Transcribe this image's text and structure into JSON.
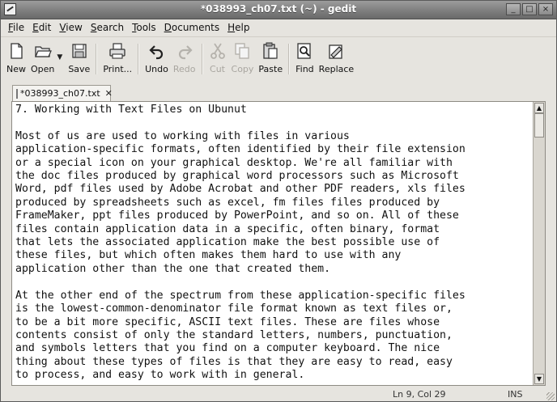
{
  "window": {
    "title": "*038993_ch07.txt (~) - gedit",
    "controls": [
      "_",
      "□",
      "×"
    ]
  },
  "menubar": {
    "items": [
      {
        "pre": "",
        "u": "F",
        "post": "ile"
      },
      {
        "pre": "",
        "u": "E",
        "post": "dit"
      },
      {
        "pre": "",
        "u": "V",
        "post": "iew"
      },
      {
        "pre": "",
        "u": "S",
        "post": "earch"
      },
      {
        "pre": "",
        "u": "T",
        "post": "ools"
      },
      {
        "pre": "",
        "u": "D",
        "post": "ocuments"
      },
      {
        "pre": "",
        "u": "H",
        "post": "elp"
      }
    ]
  },
  "toolbar": {
    "new_label": "New",
    "open_label": "Open",
    "save_label": "Save",
    "print_label": "Print...",
    "undo_label": "Undo",
    "redo_label": "Redo",
    "cut_label": "Cut",
    "copy_label": "Copy",
    "paste_label": "Paste",
    "find_label": "Find",
    "replace_label": "Replace"
  },
  "tab": {
    "label": "*038993_ch07.txt",
    "close": "✕"
  },
  "editor": {
    "text": "7. Working with Text Files on Ubunut\n\nMost of us are used to working with files in various\napplication-specific formats, often identified by their file extension\nor a special icon on your graphical desktop. We're all familiar with\nthe doc files produced by graphical word processors such as Microsoft\nWord, pdf files used by Adobe Acrobat and other PDF readers, xls files\nproduced by spreadsheets such as excel, fm files files produced by\nFrameMaker, ppt files produced by PowerPoint, and so on. All of these\nfiles contain application data in a specific, often binary, format\nthat lets the associated application make the best possible use of\nthese files, but which often makes them hard to use with any\napplication other than the one that created them.\n\nAt the other end of the spectrum from these application-specific files\nis the lowest-common-denominator file format known as text files or,\nto be a bit more specific, ASCII text files. These are files whose\ncontents consist of only the standard letters, numbers, punctuation,\nand symbols letters that you find on a computer keyboard. The nice\nthing about these types of files is that they are easy to read, easy\nto process, and easy to work with in general."
  },
  "statusbar": {
    "position": "Ln 9, Col 29",
    "mode": "INS"
  }
}
